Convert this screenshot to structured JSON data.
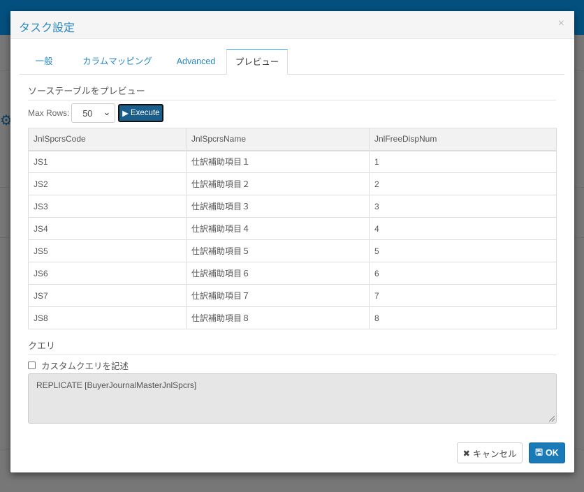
{
  "dialog": {
    "title": "タスク設定",
    "close_icon": "×"
  },
  "tabs": [
    {
      "label": "一般"
    },
    {
      "label": "カラムマッピング"
    },
    {
      "label": "Advanced"
    },
    {
      "label": "プレビュー",
      "active": true
    }
  ],
  "preview": {
    "section_title": "ソーステーブルをプレビュー",
    "max_rows_label": "Max Rows:",
    "max_rows_value": "50",
    "execute_label": "Execute",
    "columns": [
      "JnlSpcrsCode",
      "JnlSpcrsName",
      "JnlFreeDispNum"
    ],
    "rows": [
      [
        "JS1",
        "仕訳補助項目１",
        "1"
      ],
      [
        "JS2",
        "仕訳補助項目２",
        "2"
      ],
      [
        "JS3",
        "仕訳補助項目３",
        "3"
      ],
      [
        "JS4",
        "仕訳補助項目４",
        "4"
      ],
      [
        "JS5",
        "仕訳補助項目５",
        "5"
      ],
      [
        "JS6",
        "仕訳補助項目６",
        "6"
      ],
      [
        "JS7",
        "仕訳補助項目７",
        "7"
      ],
      [
        "JS8",
        "仕訳補助項目８",
        "8"
      ]
    ]
  },
  "query": {
    "section_title": "クエリ",
    "custom_query_label": "カスタムクエリを記述",
    "custom_query_checked": false,
    "text": "REPLICATE [BuyerJournalMasterJnlSpcrs]"
  },
  "footer": {
    "cancel_label": "キャンセル",
    "ok_label": "OK"
  }
}
